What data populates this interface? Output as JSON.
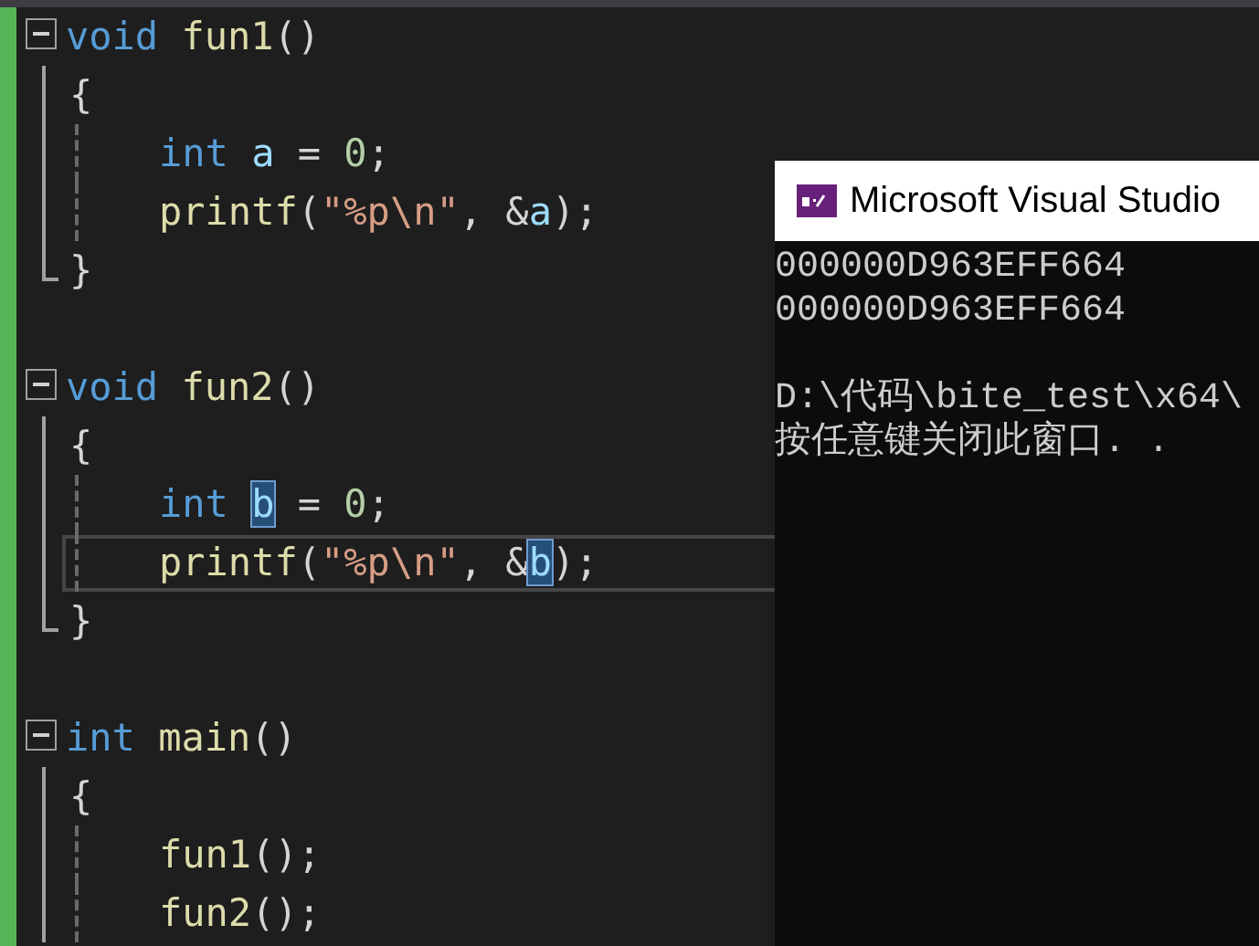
{
  "editor": {
    "lines": [
      {
        "kind": "signature",
        "expanded": true,
        "tokens": [
          {
            "kind": "keyword",
            "text": "void"
          },
          {
            "kind": "function",
            "text": " fun1"
          },
          {
            "kind": "plain",
            "text": "()"
          }
        ]
      },
      {
        "kind": "open",
        "tokens": [
          {
            "kind": "plain",
            "text": "{"
          }
        ]
      },
      {
        "kind": "body",
        "tokens": [
          {
            "kind": "keyword",
            "text": "int"
          },
          {
            "kind": "variable",
            "text": " a"
          },
          {
            "kind": "plain",
            "text": " = "
          },
          {
            "kind": "number",
            "text": "0"
          },
          {
            "kind": "plain",
            "text": ";"
          }
        ]
      },
      {
        "kind": "body",
        "tokens": [
          {
            "kind": "function",
            "text": "printf"
          },
          {
            "kind": "plain",
            "text": "("
          },
          {
            "kind": "string",
            "text": "\"%p\\n\""
          },
          {
            "kind": "plain",
            "text": ", &"
          },
          {
            "kind": "variable",
            "text": "a"
          },
          {
            "kind": "plain",
            "text": ");"
          }
        ]
      },
      {
        "kind": "close",
        "tokens": [
          {
            "kind": "plain",
            "text": "}"
          }
        ]
      },
      {
        "kind": "blank"
      },
      {
        "kind": "signature",
        "expanded": true,
        "tokens": [
          {
            "kind": "keyword",
            "text": "void"
          },
          {
            "kind": "function",
            "text": " fun2"
          },
          {
            "kind": "plain",
            "text": "()"
          }
        ]
      },
      {
        "kind": "open",
        "tokens": [
          {
            "kind": "plain",
            "text": "{"
          }
        ]
      },
      {
        "kind": "body",
        "tokens": [
          {
            "kind": "keyword",
            "text": "int "
          },
          {
            "kind": "variable",
            "text": "b",
            "highlighted": true
          },
          {
            "kind": "plain",
            "text": " = "
          },
          {
            "kind": "number",
            "text": "0"
          },
          {
            "kind": "plain",
            "text": ";"
          }
        ]
      },
      {
        "kind": "body",
        "current": true,
        "tokens": [
          {
            "kind": "function",
            "text": "printf"
          },
          {
            "kind": "plain",
            "text": "("
          },
          {
            "kind": "string",
            "text": "\"%p\\n\""
          },
          {
            "kind": "plain",
            "text": ", &"
          },
          {
            "kind": "variable",
            "text": "b",
            "highlighted": true
          },
          {
            "kind": "plain",
            "text": ");"
          }
        ]
      },
      {
        "kind": "close",
        "tokens": [
          {
            "kind": "plain",
            "text": "}"
          }
        ]
      },
      {
        "kind": "blank"
      },
      {
        "kind": "signature",
        "expanded": true,
        "tokens": [
          {
            "kind": "keyword",
            "text": "int"
          },
          {
            "kind": "function",
            "text": " main"
          },
          {
            "kind": "plain",
            "text": "()"
          }
        ]
      },
      {
        "kind": "open",
        "tokens": [
          {
            "kind": "plain",
            "text": "{"
          }
        ]
      },
      {
        "kind": "body",
        "tokens": [
          {
            "kind": "function",
            "text": "fun1"
          },
          {
            "kind": "plain",
            "text": "();"
          }
        ]
      },
      {
        "kind": "body",
        "tokens": [
          {
            "kind": "function",
            "text": "fun2"
          },
          {
            "kind": "plain",
            "text": "();"
          }
        ]
      }
    ]
  },
  "console": {
    "title": "Microsoft Visual Studio",
    "lines": [
      {
        "text": "000000D963EFF664"
      },
      {
        "text": "000000D963EFF664"
      },
      {
        "text": "D:\\代码\\bite_test\\x64\\",
        "gap_before": true
      },
      {
        "text": "按任意键关闭此窗口. ."
      }
    ]
  }
}
